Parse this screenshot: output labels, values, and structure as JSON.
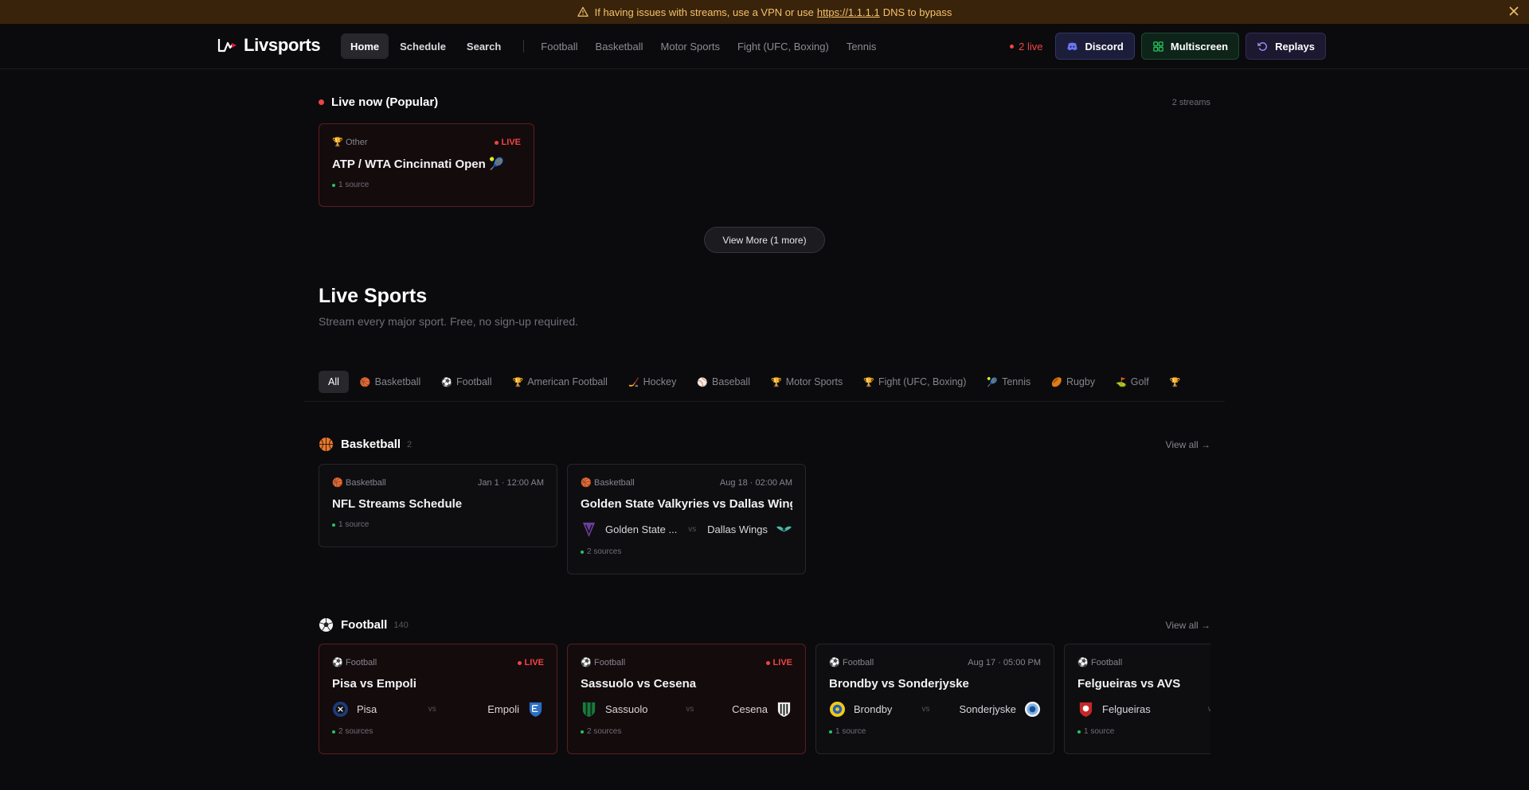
{
  "banner": {
    "text_before": "If having issues with streams, use a VPN or use",
    "link": "https://1.1.1.1",
    "text_after": "DNS to bypass",
    "color": "#f3c26b"
  },
  "nav": {
    "brand": "Livsports",
    "links": [
      "Home",
      "Schedule",
      "Search"
    ],
    "sports": [
      "Football",
      "Basketball",
      "Motor Sports",
      "Fight (UFC, Boxing)",
      "Tennis"
    ],
    "live_count": "2 live",
    "buttons": {
      "discord": "Discord",
      "multiscreen": "Multiscreen",
      "replays": "Replays"
    }
  },
  "live_now": {
    "title": "Live now (Popular)",
    "count": "2 streams",
    "card": {
      "category": "Other",
      "badge": "LIVE",
      "title": "ATP / WTA Cincinnati Open 🎾",
      "sources": "1 source"
    },
    "view_more": "View More (1 more)"
  },
  "hero": {
    "title": "Live Sports",
    "subtitle": "Stream every major sport. Free, no sign-up required."
  },
  "filters": [
    {
      "emoji": "",
      "label": "All"
    },
    {
      "emoji": "🏀",
      "label": "Basketball"
    },
    {
      "emoji": "⚽",
      "label": "Football"
    },
    {
      "emoji": "🏆",
      "label": "American Football"
    },
    {
      "emoji": "🏒",
      "label": "Hockey"
    },
    {
      "emoji": "⚾",
      "label": "Baseball"
    },
    {
      "emoji": "🏆",
      "label": "Motor Sports"
    },
    {
      "emoji": "🏆",
      "label": "Fight (UFC, Boxing)"
    },
    {
      "emoji": "🎾",
      "label": "Tennis"
    },
    {
      "emoji": "🏉",
      "label": "Rugby"
    },
    {
      "emoji": "⛳",
      "label": "Golf"
    },
    {
      "emoji": "🏆",
      "label": ""
    }
  ],
  "basketball": {
    "title": "Basketball",
    "count": "2",
    "view_all": "View all →",
    "cards": [
      {
        "category": "Basketball",
        "time": "Jan 1 · 12:00 AM",
        "title": "NFL Streams Schedule",
        "sources": "1 source"
      },
      {
        "category": "Basketball",
        "time": "Aug 18 · 02:00 AM",
        "title": "Golden State Valkyries vs Dallas Wings",
        "home": "Golden State ...",
        "vs": "vs",
        "away": "Dallas Wings",
        "sources": "2 sources"
      }
    ]
  },
  "football": {
    "title": "Football",
    "count": "140",
    "view_all": "View all →",
    "cards": [
      {
        "category": "Football",
        "badge": "LIVE",
        "title": "Pisa vs Empoli",
        "home": "Pisa",
        "vs": "vs",
        "away": "Empoli",
        "sources": "2 sources"
      },
      {
        "category": "Football",
        "badge": "LIVE",
        "title": "Sassuolo vs Cesena",
        "home": "Sassuolo",
        "vs": "vs",
        "away": "Cesena",
        "sources": "2 sources"
      },
      {
        "category": "Football",
        "time": "Aug 17 · 05:00 PM",
        "title": "Brondby vs Sonderjyske",
        "home": "Brondby",
        "vs": "vs",
        "away": "Sonderjyske",
        "sources": "1 source"
      },
      {
        "category": "Football",
        "title": "Felgueiras vs AVS",
        "home": "Felgueiras",
        "vs": "vs",
        "sources": "1 source"
      }
    ]
  }
}
